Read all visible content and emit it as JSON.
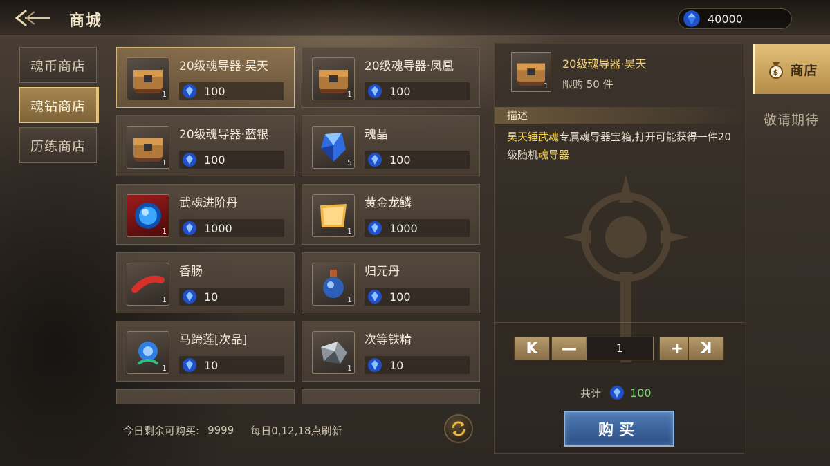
{
  "header": {
    "title": "商城",
    "currency_value": "40000"
  },
  "left_tabs": [
    {
      "label": "魂币商店",
      "active": false
    },
    {
      "label": "魂钻商店",
      "active": true
    },
    {
      "label": "历练商店",
      "active": false
    }
  ],
  "items": [
    {
      "name": "20级魂导器·昊天",
      "price": "100",
      "count": "1",
      "icon": "chest-icon",
      "selected": true
    },
    {
      "name": "20级魂导器·凤凰",
      "price": "100",
      "count": "1",
      "icon": "chest-icon",
      "selected": false
    },
    {
      "name": "20级魂导器·蓝银",
      "price": "100",
      "count": "1",
      "icon": "chest-icon",
      "selected": false
    },
    {
      "name": "魂晶",
      "price": "100",
      "count": "5",
      "icon": "crystal-icon",
      "selected": false
    },
    {
      "name": "武魂进阶丹",
      "price": "1000",
      "count": "1",
      "icon": "orb-icon",
      "selected": false
    },
    {
      "name": "黄金龙鳞",
      "price": "1000",
      "count": "1",
      "icon": "scroll-icon",
      "selected": false
    },
    {
      "name": "香肠",
      "price": "10",
      "count": "1",
      "icon": "sausage-icon",
      "selected": false
    },
    {
      "name": "归元丹",
      "price": "100",
      "count": "1",
      "icon": "potion-icon",
      "selected": false
    },
    {
      "name": "马蹄莲[次品]",
      "price": "10",
      "count": "1",
      "icon": "flower-icon",
      "selected": false
    },
    {
      "name": "次等铁精",
      "price": "10",
      "count": "1",
      "icon": "iron-ore-icon",
      "selected": false
    }
  ],
  "footer": {
    "remaining_label": "今日剩余可购买:",
    "remaining_value": "9999",
    "refresh_note": "每日0,12,18点刷新"
  },
  "detail": {
    "name": "20级魂导器·昊天",
    "count": "1",
    "limit": "限购 50 件",
    "desc_title": "描述",
    "desc_hl1": "昊天锤武魂",
    "desc_mid": "专属魂导器宝箱,打开可能获得一件20级随机",
    "desc_hl2": "魂导器",
    "quantity": "1",
    "total_label": "共计",
    "total_value": "100",
    "buy_label": "购买",
    "first_label": "K",
    "minus_label": "—",
    "plus_label": "+",
    "last_label": "K"
  },
  "right_tabs": [
    {
      "label": "商店",
      "active": true
    },
    {
      "label": "敬请期待",
      "active": false
    }
  ],
  "colors": {
    "accent_gold": "#e3c07a",
    "highlight": "#f3cf4a",
    "total_green": "#6fe06a",
    "buy_blue": "#3d66a0"
  }
}
